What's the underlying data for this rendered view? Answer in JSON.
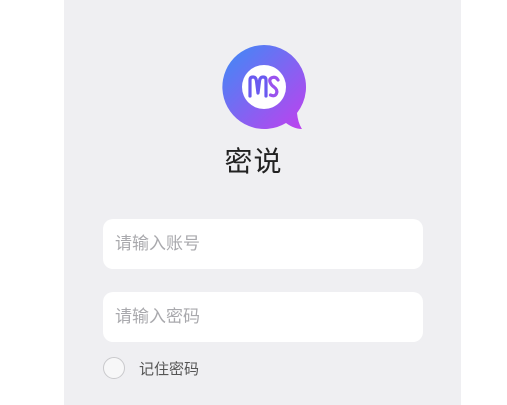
{
  "app": {
    "name": "密说",
    "logo_text": "MS"
  },
  "login": {
    "account_placeholder": "请输入账号",
    "account_value": "",
    "password_placeholder": "请输入密码",
    "password_value": "",
    "remember_label": "记住密码",
    "remember_checked": false
  },
  "colors": {
    "panel_background": "#efeff2",
    "logo_gradient_start": "#3b8cf6",
    "logo_gradient_end": "#c040ee",
    "field_background": "#ffffff",
    "placeholder_text": "#a9a9ad"
  }
}
